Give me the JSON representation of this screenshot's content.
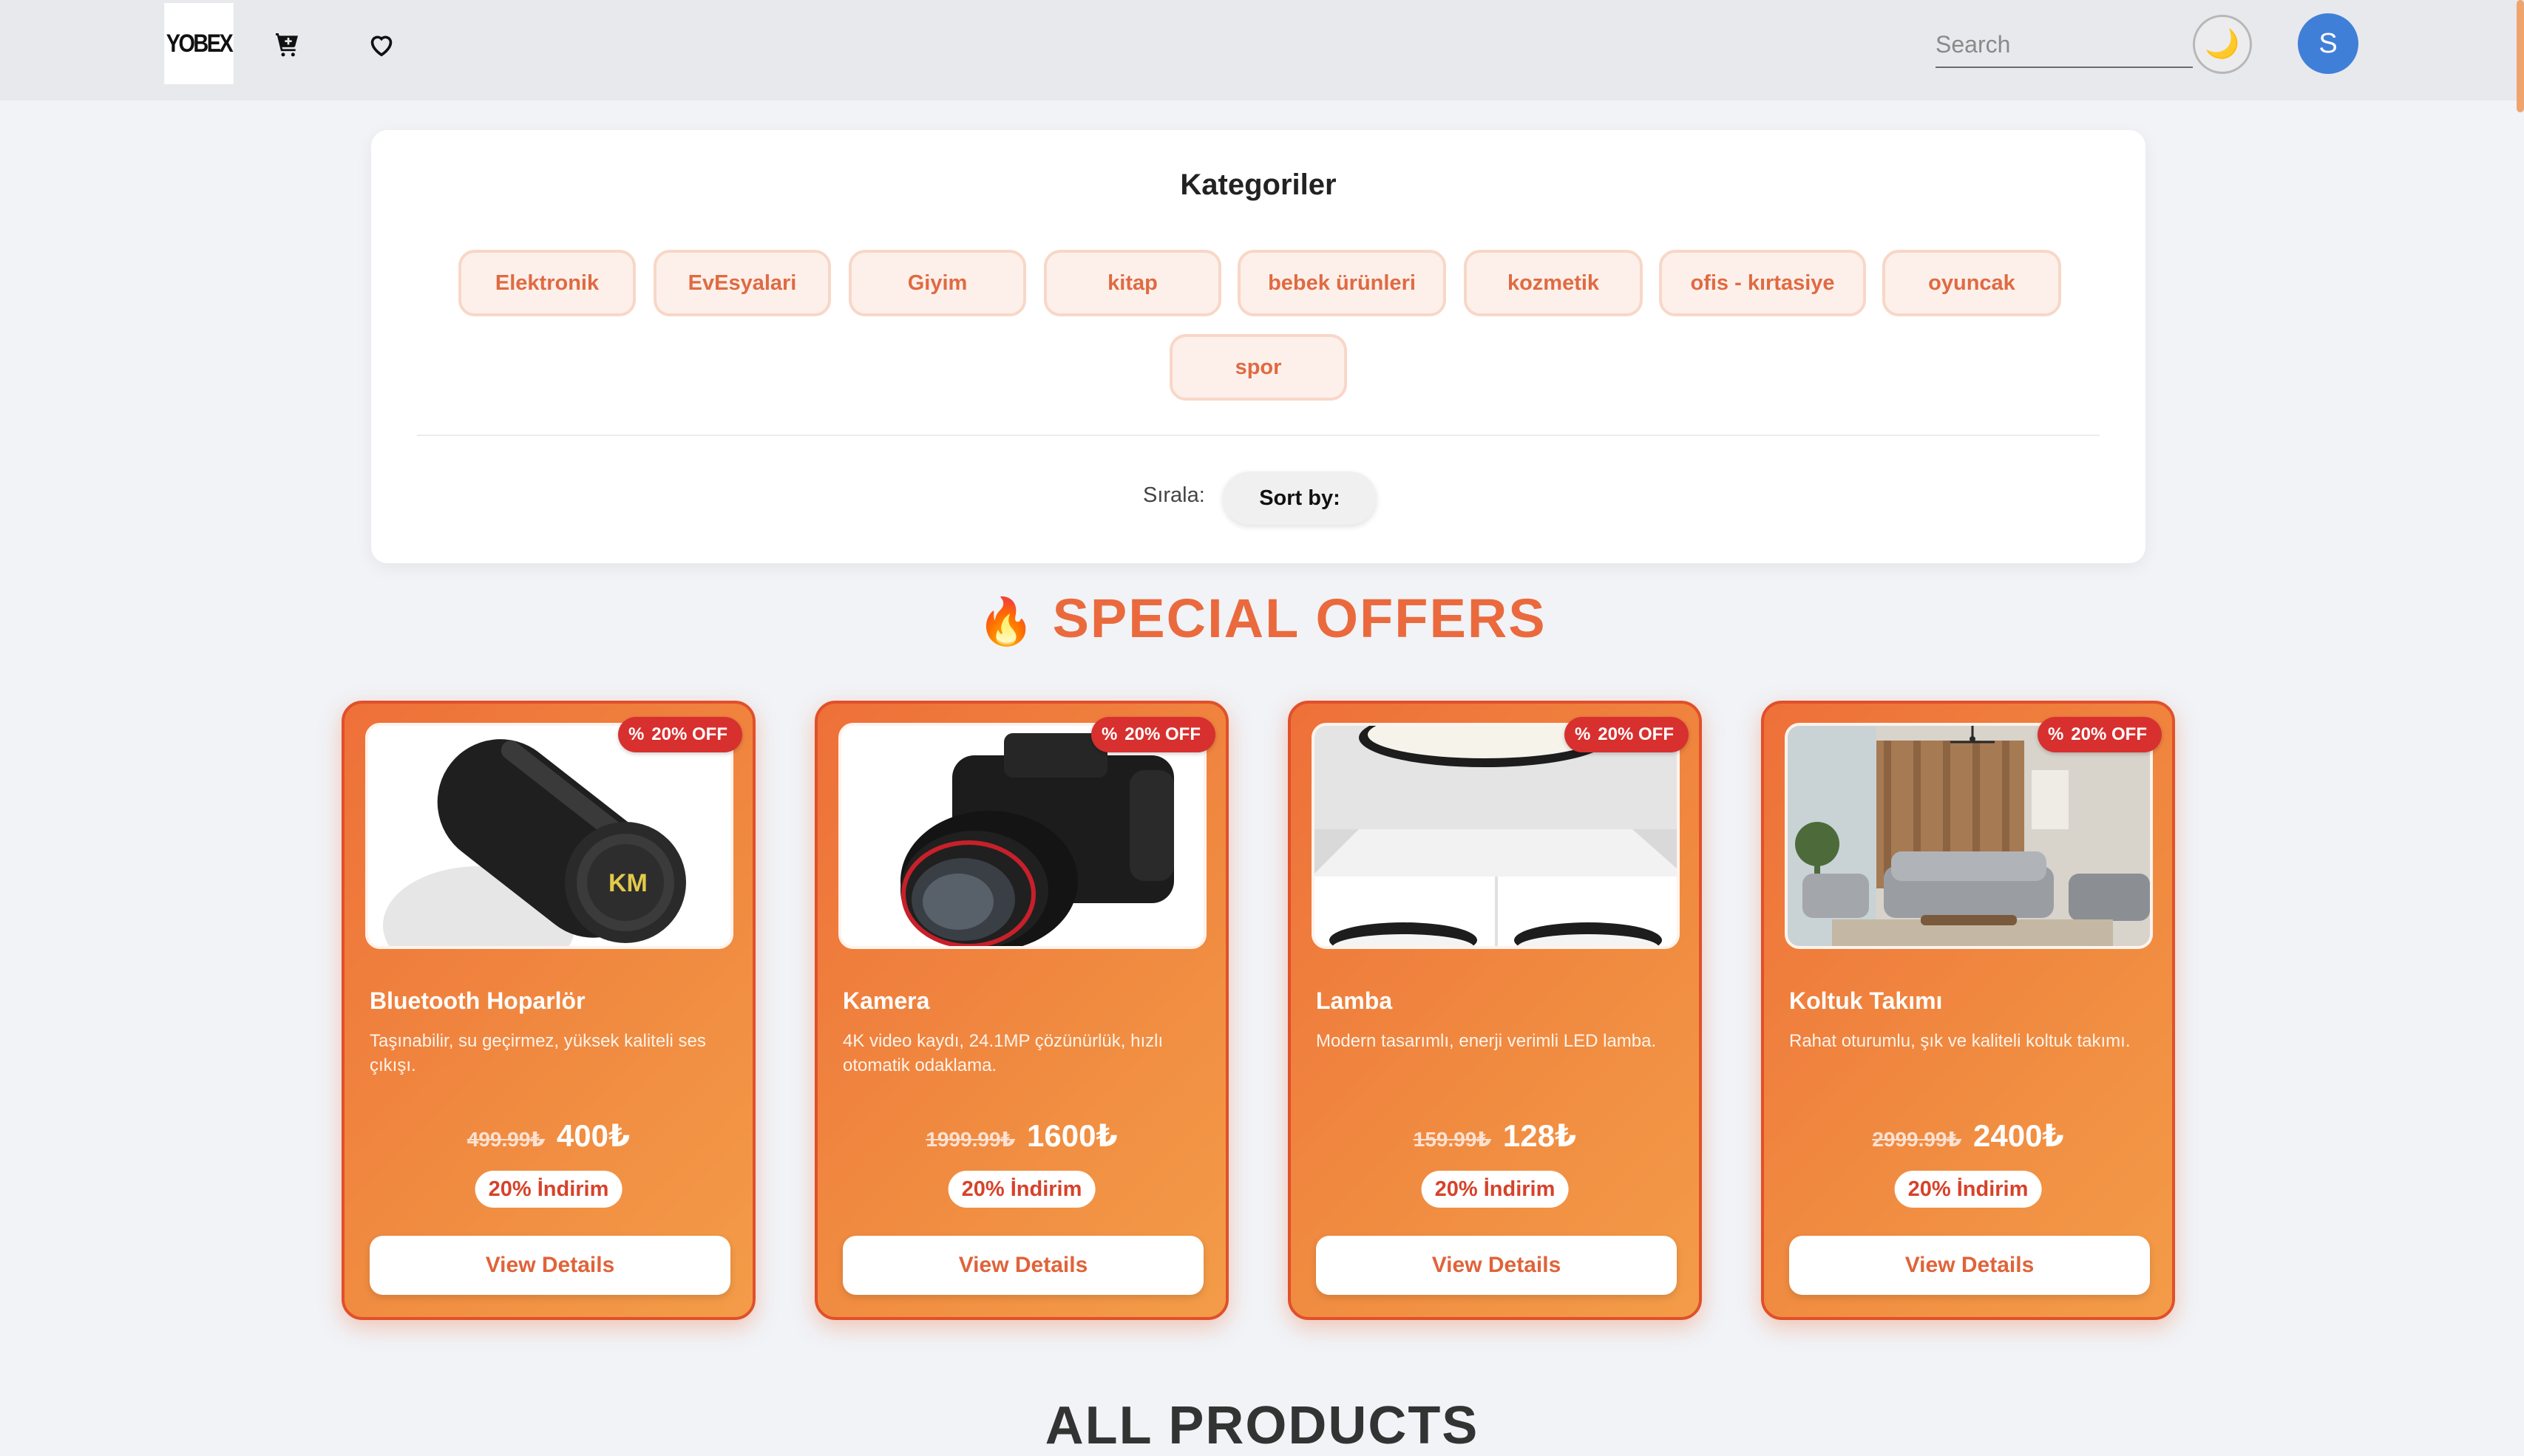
{
  "header": {
    "logo_text": "YOBEX",
    "search_placeholder": "Search",
    "avatar_letter": "S",
    "theme_icon": "moon-icon",
    "icons": [
      "cart-icon",
      "heart-icon"
    ]
  },
  "categories": {
    "title": "Kategoriler",
    "items": [
      "Elektronik",
      "EvEsyalari",
      "Giyim",
      "kitap",
      "bebek ürünleri",
      "kozmetik",
      "ofis - kırtasiye",
      "oyuncak",
      "spor"
    ],
    "sort_label": "Sırala:",
    "sort_button": "Sort by:"
  },
  "offers": {
    "title": "SPECIAL OFFERS",
    "products": [
      {
        "name": "Bluetooth Hoparlör",
        "description": "Taşınabilir, su geçirmez, yüksek kaliteli ses çıkışı.",
        "old_price": "499.99₺",
        "new_price": "400₺",
        "badge": "20% OFF",
        "discount_label": "20% İndirim",
        "button": "View Details"
      },
      {
        "name": "Kamera",
        "description": "4K video kaydı, 24.1MP çözünürlük, hızlı otomatik odaklama.",
        "old_price": "1999.99₺",
        "new_price": "1600₺",
        "badge": "20% OFF",
        "discount_label": "20% İndirim",
        "button": "View Details"
      },
      {
        "name": "Lamba",
        "description": "Modern tasarımlı, enerji verimli LED lamba.",
        "old_price": "159.99₺",
        "new_price": "128₺",
        "badge": "20% OFF",
        "discount_label": "20% İndirim",
        "button": "View Details"
      },
      {
        "name": "Koltuk Takımı",
        "description": "Rahat oturumlu, şık ve kaliteli koltuk takımı.",
        "old_price": "2999.99₺",
        "new_price": "2400₺",
        "badge": "20% OFF",
        "discount_label": "20% İndirim",
        "button": "View Details"
      }
    ]
  },
  "all_products": {
    "title": "ALL PRODUCTS"
  },
  "colors": {
    "accent": "#ea6a3d",
    "badge": "#d7302f",
    "chip_bg": "#fdf0ea",
    "avatar": "#3f7fd8"
  }
}
